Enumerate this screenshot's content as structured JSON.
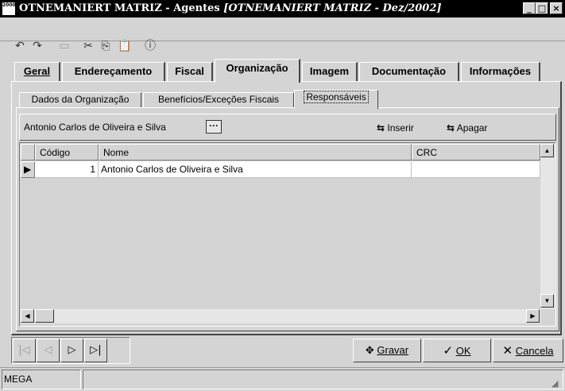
{
  "window": {
    "logo_text": "2000",
    "title_prefix": "OTNEMANIERT MATRIZ -  Agentes ",
    "title_italic": "[OTNEMANIERT MATRIZ - Dez/2002]",
    "minimize": "_",
    "maximize": "□",
    "close": "×"
  },
  "toolbar": {
    "icons": [
      "undo-icon",
      "redo-icon",
      "minus-icon",
      "cut-icon",
      "copy-icon",
      "paste-icon",
      "info-icon"
    ]
  },
  "tabs": [
    {
      "label": "Geral"
    },
    {
      "label": "Endereçamento"
    },
    {
      "label": "Fiscal"
    },
    {
      "label": "Organização",
      "active": true
    },
    {
      "label": "Imagem"
    },
    {
      "label": "Documentação"
    },
    {
      "label": "Informações"
    }
  ],
  "subtabs": [
    {
      "label": "Dados da Organização"
    },
    {
      "label": "Benefícios/Exceções Fiscais"
    },
    {
      "label": "Responsáveis",
      "active": true
    }
  ],
  "selector": {
    "value": "Antonio Carlos de Oliveira e Silva",
    "button": "···"
  },
  "actions": {
    "insert": "Inserir",
    "delete": "Apagar"
  },
  "grid": {
    "columns": [
      "Código",
      "Nome",
      "CRC"
    ],
    "rows": [
      {
        "codigo": "1",
        "nome": "Antonio Carlos de Oliveira e Silva",
        "crc": ""
      }
    ]
  },
  "bottom": {
    "save": "Gravar",
    "ok": "OK",
    "cancel": "Cancela"
  },
  "status": {
    "text": "MEGA"
  }
}
